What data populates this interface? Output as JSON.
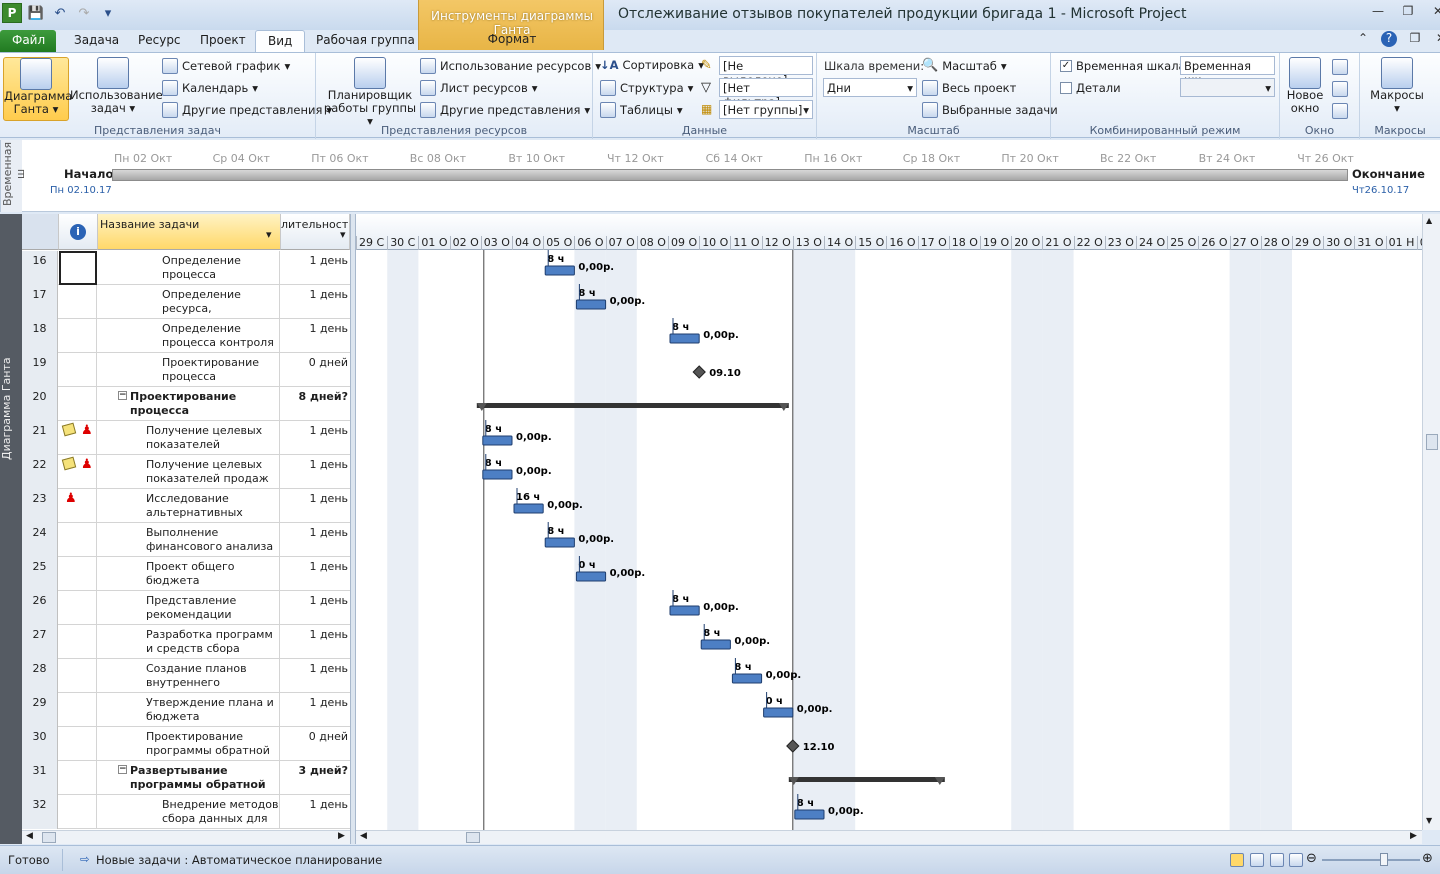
{
  "title_bar": {
    "window_title": "Отслеживание отзывов покупателей продукции бригада 1  -  Microsoft Project",
    "context_group": "Инструменты диаграммы Ганта",
    "context_tab": "Формат",
    "app_logo": "P"
  },
  "tabs": [
    "Файл",
    "Задача",
    "Ресурс",
    "Проект",
    "Вид",
    "Рабочая группа"
  ],
  "ribbon": {
    "task_views": {
      "gantt": "Диаграмма Ганта",
      "usage": "Использование задач",
      "network": "Сетевой график",
      "calendar": "Календарь",
      "other": "Другие представления",
      "label": "Представления задач"
    },
    "resource_views": {
      "planner": "Планировщик работы группы",
      "usage": "Использование ресурсов",
      "sheet": "Лист ресурсов",
      "other": "Другие представления",
      "label": "Представления ресурсов"
    },
    "data": {
      "sort": "Сортировка",
      "outline": "Структура",
      "tables": "Таблицы",
      "highlight": "[Не выделено]",
      "filter": "[Нет фильтра]",
      "group": "[Нет группы]",
      "label": "Данные"
    },
    "zoom": {
      "scale_label": "Шкала времени:",
      "scale_value": "Дни",
      "zoom": "Масштаб",
      "entire": "Весь проект",
      "selected": "Выбранные задачи",
      "label": "Масштаб"
    },
    "split": {
      "timeline_chk": "Временная шкала",
      "timeline_sel": "Временная шк",
      "details_chk": "Детали",
      "label": "Комбинированный режим"
    },
    "window": {
      "new": "Новое окно",
      "label": "Окно"
    },
    "macros": {
      "btn": "Макросы",
      "label": "Макросы"
    }
  },
  "timeline": {
    "side": "Временная ш",
    "start_label": "Начало",
    "start_date": "Пн 02.10.17",
    "end_label": "Окончание",
    "end_date": "Чт26.10.17",
    "ticks": [
      "Пн 02 Окт",
      "Ср 04 Окт",
      "Пт 06 Окт",
      "Вс 08 Окт",
      "Вт 10 Окт",
      "Чт 12 Окт",
      "Сб 14 Окт",
      "Пн 16 Окт",
      "Ср 18 Окт",
      "Пт 20 Окт",
      "Вс 22 Окт",
      "Вт 24 Окт",
      "Чт 26 Окт"
    ]
  },
  "side_label": "Диаграмма Ганта",
  "grid": {
    "col_name": "Название задачи",
    "col_dur": "лительност",
    "rows": [
      {
        "id": "16",
        "name": "Определение процесса разрешения",
        "dur": "1 день",
        "sum": false,
        "ind": ""
      },
      {
        "id": "17",
        "name": "Определение ресурса, ответственного за",
        "dur": "1 день",
        "sum": false,
        "ind": ""
      },
      {
        "id": "18",
        "name": "Определение процесса контроля",
        "dur": "1 день",
        "sum": false,
        "ind": ""
      },
      {
        "id": "19",
        "name": "Проектирование процесса",
        "dur": "0 дней",
        "sum": false,
        "ind": ""
      },
      {
        "id": "20",
        "name": "Проектирование процесса отслеживания",
        "dur": "8 дней?",
        "sum": true,
        "ind": ""
      },
      {
        "id": "21",
        "name": "Получение целевых показателей",
        "dur": "1 день",
        "sum": false,
        "ind": "note-person"
      },
      {
        "id": "22",
        "name": "Получение целевых показателей продаж",
        "dur": "1 день",
        "sum": false,
        "ind": "note-person"
      },
      {
        "id": "23",
        "name": "Исследование альтернативных",
        "dur": "1 день",
        "sum": false,
        "ind": "person"
      },
      {
        "id": "24",
        "name": "Выполнение финансового анализа",
        "dur": "1 день",
        "sum": false,
        "ind": ""
      },
      {
        "id": "25",
        "name": "Проект общего бюджета",
        "dur": "1 день",
        "sum": false,
        "ind": ""
      },
      {
        "id": "26",
        "name": "Представление рекомендации",
        "dur": "1 день",
        "sum": false,
        "ind": ""
      },
      {
        "id": "27",
        "name": "Разработка программ и средств сбора отзывов",
        "dur": "1 день",
        "sum": false,
        "ind": ""
      },
      {
        "id": "28",
        "name": "Создание планов внутреннего",
        "dur": "1 день",
        "sum": false,
        "ind": ""
      },
      {
        "id": "29",
        "name": "Утверждение плана и бюджета руководством",
        "dur": "1 день",
        "sum": false,
        "ind": ""
      },
      {
        "id": "30",
        "name": "Проектирование программы обратной",
        "dur": "0 дней",
        "sum": false,
        "ind": ""
      },
      {
        "id": "31",
        "name": "Развертывание программы обратной",
        "dur": "3 дней?",
        "sum": true,
        "ind": ""
      },
      {
        "id": "32",
        "name": "Внедрение методов сбора данных для всех",
        "dur": "1 день",
        "sum": false,
        "ind": ""
      }
    ]
  },
  "gantt": {
    "days": [
      "29 С",
      "30 С",
      "01 О",
      "02 О",
      "03 О",
      "04 О",
      "05 О",
      "06 О",
      "07 О",
      "08 О",
      "09 О",
      "10 О",
      "11 О",
      "12 О",
      "13 О",
      "14 О",
      "15 О",
      "16 О",
      "17 О",
      "18 О",
      "19 О",
      "20 О",
      "21 О",
      "22 О",
      "23 О",
      "24 О",
      "25 О",
      "26 О",
      "27 О",
      "28 О",
      "29 О",
      "30 О",
      "31 О",
      "01 Н",
      "02"
    ],
    "weekend_days": [
      1,
      7,
      8,
      14,
      15,
      21,
      22,
      28,
      29
    ],
    "bars": [
      {
        "row": 0,
        "start": 6,
        "len": 1,
        "work": "8 ч",
        "cost": "0,00р."
      },
      {
        "row": 1,
        "start": 7,
        "len": 1,
        "work": "8 ч",
        "cost": "0,00р."
      },
      {
        "row": 2,
        "start": 10,
        "len": 1,
        "work": "8 ч",
        "cost": "0,00р."
      },
      {
        "row": 5,
        "start": 4,
        "len": 1,
        "work": "8 ч",
        "cost": "0,00р."
      },
      {
        "row": 6,
        "start": 4,
        "len": 1,
        "work": "8 ч",
        "cost": "0,00р."
      },
      {
        "row": 7,
        "start": 5,
        "len": 1,
        "work": "16 ч",
        "cost": "0,00р."
      },
      {
        "row": 8,
        "start": 6,
        "len": 1,
        "work": "8 ч",
        "cost": "0,00р."
      },
      {
        "row": 9,
        "start": 7,
        "len": 1,
        "work": "0 ч",
        "cost": "0,00р."
      },
      {
        "row": 10,
        "start": 10,
        "len": 1,
        "work": "8 ч",
        "cost": "0,00р."
      },
      {
        "row": 11,
        "start": 11,
        "len": 1,
        "work": "8 ч",
        "cost": "0,00р."
      },
      {
        "row": 12,
        "start": 12,
        "len": 1,
        "work": "8 ч",
        "cost": "0,00р."
      },
      {
        "row": 13,
        "start": 13,
        "len": 1,
        "work": "0 ч",
        "cost": "0,00р."
      },
      {
        "row": 16,
        "start": 14,
        "len": 1,
        "work": "8 ч",
        "cost": "0,00р."
      }
    ],
    "milestones": [
      {
        "row": 3,
        "day": 11,
        "label": "09.10"
      },
      {
        "row": 14,
        "day": 14,
        "label": "12.10"
      }
    ],
    "summaries": [
      {
        "row": 4,
        "start": 4,
        "len": 10
      },
      {
        "row": 15,
        "start": 14,
        "len": 5
      }
    ]
  },
  "status": {
    "ready": "Готово",
    "mode": "Новые задачи : Автоматическое планирование"
  },
  "colors": {
    "bar": "#4d7fc4",
    "ribbon_selected": "#ffcc4d",
    "file_tab": "#2e8b2e"
  }
}
